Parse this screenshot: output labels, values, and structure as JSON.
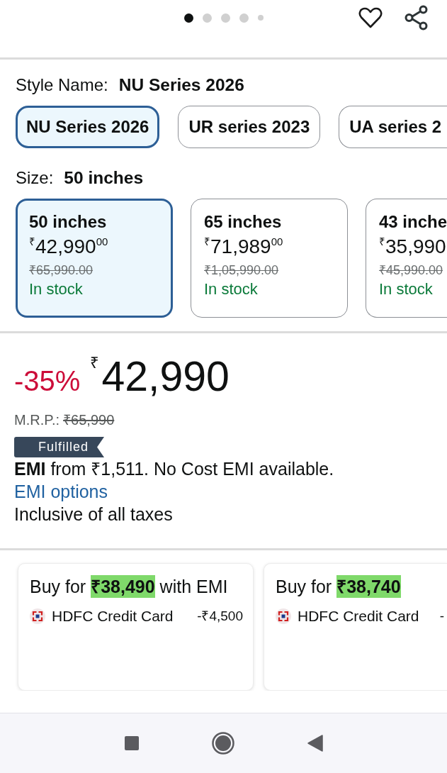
{
  "carousel": {
    "dots": [
      {
        "selected": true
      },
      {
        "selected": false
      },
      {
        "selected": false
      },
      {
        "selected": false
      },
      {
        "selected": false
      }
    ]
  },
  "style": {
    "label": "Style Name:",
    "value": "NU Series 2026",
    "options": [
      {
        "label": "NU Series 2026",
        "selected": true
      },
      {
        "label": "UR series 2023",
        "selected": false
      },
      {
        "label": "UA series 2",
        "selected": false
      }
    ]
  },
  "size": {
    "label": "Size:",
    "value": "50 inches",
    "options": [
      {
        "title": "50 inches",
        "price": "$^{₹}$42,990$^{00}$",
        "mrp": "₹65,990.00",
        "availability": "In stock",
        "selected": true
      },
      {
        "title": "65 inches",
        "price": "$^{₹}$71,989$^{00}$",
        "mrp": "₹1,05,990.00",
        "availability": "In stock",
        "selected": false
      },
      {
        "title": "43 inche",
        "price": "$^{₹}$35,990",
        "mrp": "₹45,990.00",
        "availability": "In stock",
        "selected": false
      }
    ]
  },
  "pricing": {
    "discount": "-35%",
    "price": "$^{₹}$42,990",
    "mrp_label": "M.R.P.:",
    "mrp": "₹65,990",
    "badge": "Fulfilled",
    "emi": "**EMI** from ₹1,511. No Cost EMI available.",
    "emi_link": "EMI options",
    "tax_note": "Inclusive of all taxes"
  },
  "offers": [
    {
      "headline": "Buy for **₹38,490** with EMI",
      "bank": "HDFC Credit Card",
      "amount": "-₹4,500"
    },
    {
      "headline": "Buy for **₹38,740**",
      "bank": "HDFC Credit Card",
      "amount": "-"
    }
  ]
}
